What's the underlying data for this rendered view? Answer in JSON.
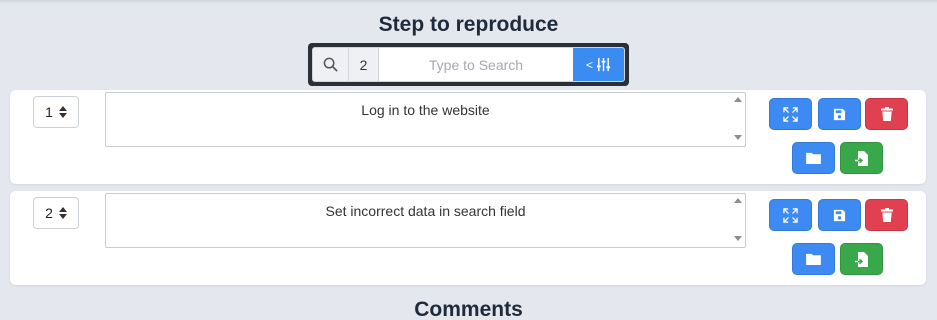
{
  "steps_section": {
    "title": "Step to reproduce"
  },
  "search": {
    "count": "2",
    "placeholder": "Type to Search",
    "filter_prefix": "<",
    "icons": {
      "search": "search-icon",
      "filter": "sliders-icon"
    }
  },
  "steps": [
    {
      "number": "1",
      "text": "Log in to the website"
    },
    {
      "number": "2",
      "text": "Set incorrect data in search field"
    }
  ],
  "step_actions": {
    "expand": "expand-icon",
    "save": "save-icon",
    "delete": "trash-icon",
    "open": "folder-icon",
    "insert": "file-import-icon"
  },
  "comments_section": {
    "title": "Comments"
  },
  "colors": {
    "background": "#e4e7ee",
    "primary": "#3d8bf2",
    "danger": "#e0404f",
    "success": "#38a84a",
    "search_frame": "#2b2f36"
  }
}
